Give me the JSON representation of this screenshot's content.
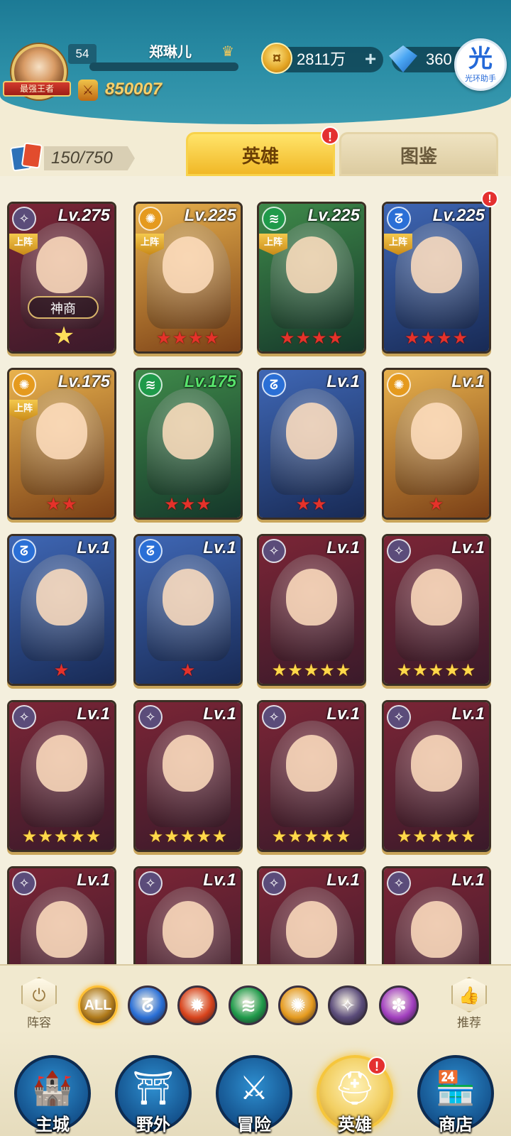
{
  "player": {
    "level": "54",
    "name": "郑琳儿",
    "title_badge": "最强王者",
    "power": "850007"
  },
  "currency": {
    "gold": "2811万",
    "gold_plus": "+",
    "gems": "360"
  },
  "helper": {
    "glyph": "光",
    "label": "光环助手"
  },
  "roster": {
    "count": "150/750"
  },
  "tabs": [
    {
      "label": "英雄",
      "active": true,
      "badge": "!"
    },
    {
      "label": "图鉴",
      "active": false
    }
  ],
  "heroes": [
    {
      "level": "Lv.275",
      "element": "dark",
      "deployed": true,
      "stars": 0,
      "star_color": "gold",
      "special": "神商",
      "badge": false
    },
    {
      "level": "Lv.225",
      "element": "light",
      "deployed": true,
      "stars": 4,
      "star_color": "red",
      "badge": false
    },
    {
      "level": "Lv.225",
      "element": "wind",
      "deployed": true,
      "stars": 4,
      "star_color": "red",
      "badge": false
    },
    {
      "level": "Lv.225",
      "element": "water",
      "deployed": true,
      "stars": 4,
      "star_color": "red",
      "badge": true
    },
    {
      "level": "Lv.175",
      "element": "light",
      "deployed": true,
      "stars": 2,
      "star_color": "red",
      "badge": false
    },
    {
      "level": "Lv.175",
      "element": "wind",
      "deployed": false,
      "stars": 3,
      "star_color": "red",
      "badge": false,
      "level_color": "#57e36b"
    },
    {
      "level": "Lv.1",
      "element": "water",
      "deployed": false,
      "stars": 2,
      "star_color": "red",
      "badge": false
    },
    {
      "level": "Lv.1",
      "element": "light",
      "deployed": false,
      "stars": 1,
      "star_color": "red",
      "badge": false
    },
    {
      "level": "Lv.1",
      "element": "water",
      "deployed": false,
      "stars": 1,
      "star_color": "red",
      "badge": false
    },
    {
      "level": "Lv.1",
      "element": "water",
      "deployed": false,
      "stars": 1,
      "star_color": "red",
      "badge": false
    },
    {
      "level": "Lv.1",
      "element": "dark",
      "deployed": false,
      "stars": 5,
      "star_color": "gold",
      "badge": false
    },
    {
      "level": "Lv.1",
      "element": "dark",
      "deployed": false,
      "stars": 5,
      "star_color": "gold",
      "badge": false
    },
    {
      "level": "Lv.1",
      "element": "dark",
      "deployed": false,
      "stars": 5,
      "star_color": "gold",
      "badge": false
    },
    {
      "level": "Lv.1",
      "element": "dark",
      "deployed": false,
      "stars": 5,
      "star_color": "gold",
      "badge": false
    },
    {
      "level": "Lv.1",
      "element": "dark",
      "deployed": false,
      "stars": 5,
      "star_color": "gold",
      "badge": false
    },
    {
      "level": "Lv.1",
      "element": "dark",
      "deployed": false,
      "stars": 5,
      "star_color": "gold",
      "badge": false
    },
    {
      "level": "Lv.1",
      "element": "dark",
      "deployed": false,
      "stars": 0,
      "star_color": "gold",
      "badge": false
    },
    {
      "level": "Lv.1",
      "element": "dark",
      "deployed": false,
      "stars": 0,
      "star_color": "gold",
      "badge": false
    },
    {
      "level": "Lv.1",
      "element": "dark",
      "deployed": false,
      "stars": 0,
      "star_color": "gold",
      "badge": false
    },
    {
      "level": "Lv.1",
      "element": "dark",
      "deployed": false,
      "stars": 0,
      "star_color": "gold",
      "badge": false
    }
  ],
  "deploy_label": "上阵",
  "filters": {
    "left_label": "阵容",
    "right_label": "推荐",
    "items": [
      {
        "id": "all",
        "label": "ALL",
        "active": true
      },
      {
        "id": "water",
        "label": "",
        "active": false
      },
      {
        "id": "fire",
        "label": "",
        "active": false
      },
      {
        "id": "wind",
        "label": "",
        "active": false
      },
      {
        "id": "light",
        "label": "",
        "active": false
      },
      {
        "id": "dark",
        "label": "",
        "active": false
      },
      {
        "id": "arcane",
        "label": "",
        "active": false
      }
    ]
  },
  "nav": [
    {
      "label": "主城",
      "icon": "castle-icon",
      "active": false
    },
    {
      "label": "野外",
      "icon": "portal-icon",
      "active": false
    },
    {
      "label": "冒险",
      "icon": "sword-icon",
      "active": false
    },
    {
      "label": "英雄",
      "icon": "helmet-icon",
      "active": true,
      "badge": "!"
    },
    {
      "label": "商店",
      "icon": "shop-icon",
      "active": false
    }
  ],
  "colors": {
    "water": "#2a6fd6",
    "light": "#e59a1e",
    "wind": "#1f9a4a",
    "dark": "#5b4c7a",
    "fire": "#d8431c",
    "arcane": "#a23fbf",
    "all": "#b07a1a"
  }
}
